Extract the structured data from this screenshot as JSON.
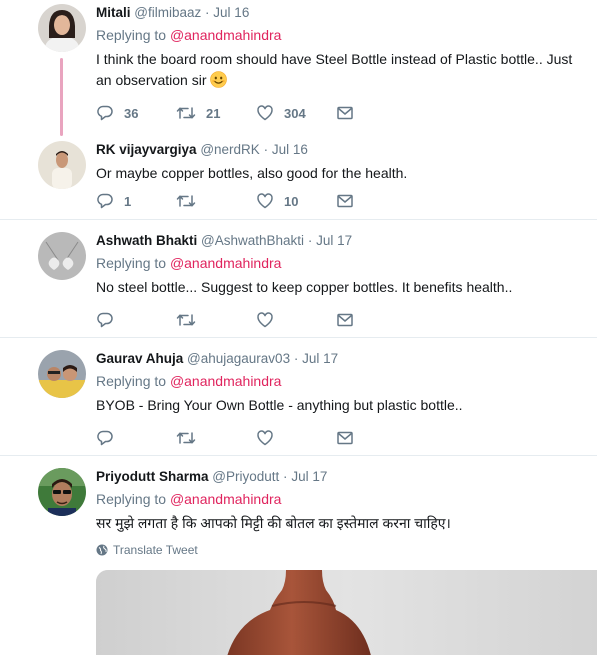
{
  "tweets": [
    {
      "name": "Mitali",
      "handle": "@filmibaaz",
      "time": "Jul 16",
      "replying_label": "Replying to",
      "replying_to": "@anandmahindra",
      "text": "I think the board room should have Steel Bottle instead of Plastic bottle.. Just an observation sir",
      "emoji": "smiling-face-emoji",
      "replies": "36",
      "retweets": "21",
      "likes": "304"
    },
    {
      "name": "RK vijayvargiya",
      "handle": "@nerdRK",
      "time": "Jul 16",
      "text": "Or maybe copper bottles, also good for the health.",
      "replies": "1",
      "retweets": "",
      "likes": "10"
    },
    {
      "name": "Ashwath Bhakti",
      "handle": "@AshwathBhakti",
      "time": "Jul 17",
      "replying_label": "Replying to",
      "replying_to": "@anandmahindra",
      "text": "No steel bottle... Suggest to keep copper bottles. It benefits health..",
      "replies": "",
      "retweets": "",
      "likes": ""
    },
    {
      "name": "Gaurav Ahuja",
      "handle": "@ahujagaurav03",
      "time": "Jul 17",
      "replying_label": "Replying to",
      "replying_to": "@anandmahindra",
      "text": "BYOB - Bring Your Own Bottle - anything but plastic bottle..",
      "replies": "",
      "retweets": "",
      "likes": ""
    },
    {
      "name": "Priyodutt Sharma",
      "handle": "@Priyodutt",
      "time": "Jul 17",
      "replying_label": "Replying to",
      "replying_to": "@anandmahindra",
      "text": "सर मुझे लगता है कि आपको मिट्टी की बोतल का इस्तेमाल करना चाहिए।",
      "translate_label": "Translate Tweet"
    }
  ],
  "separator": "·",
  "icons": {
    "reply": "reply-icon",
    "retweet": "retweet-icon",
    "like": "heart-icon",
    "dm": "envelope-icon",
    "translate": "globe-icon"
  },
  "colors": {
    "mention": "#e0245e",
    "muted": "#657786",
    "thread_line": "#e9a4bf",
    "divider": "#e6ecf0"
  }
}
